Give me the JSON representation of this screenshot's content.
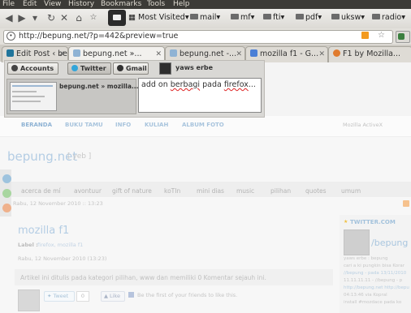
{
  "menubar": {
    "items": [
      "File",
      "Edit",
      "View",
      "History",
      "Bookmarks",
      "Tools",
      "Help"
    ]
  },
  "bookmarks": [
    "Most Visited",
    "mail",
    "mf",
    "fti",
    "pdf",
    "uksw",
    "radio"
  ],
  "url": "http://bepung.net/?p=442&preview=true",
  "tabs": [
    "Edit Post ‹ be...",
    "bepung.net »...",
    "bepung.net -...",
    "mozilla f1 - G...",
    "F1 by Mozilla..."
  ],
  "popup": {
    "accounts_label": "Accounts",
    "twitter_label": "Twitter",
    "gmail_label": "Gmail",
    "user_name": "yaws erbe",
    "share_title": "bepung.net » mozilla...",
    "compose_prefix": "add on ",
    "compose_w1": "berbagi",
    "compose_mid": " pada ",
    "compose_w2": "firefox",
    "compose_suffix": "..."
  },
  "page": {
    "nav": [
      "BERANDA",
      "BUKU TAMU",
      "INFO",
      "KULIAH",
      "ALBUM FOTO"
    ],
    "nav_right": "Mozilla ActiveX",
    "site_title": "bepung.net",
    "site_tag": "[ yeb ]",
    "categories": [
      "acerca de mí",
      "avontuur",
      "gift of nature",
      "koTIn",
      "mini dias",
      "music",
      "pilihan",
      "quotes",
      "umum"
    ],
    "date_bar": "Rabu, 12 November 2010 :: 13:23",
    "post_title": "mozilla f1",
    "label_prefix": "Label :",
    "label_value": "firefox, mozilla f1",
    "post_date": "Rabu, 12 November 2010 (13:23)",
    "post_excerpt": "Artikel ini ditulis pada kategori pilihan, www dan memiliki 0 Komentar sejauh ini.",
    "tweet_label": "Tweet",
    "tweet_count": "0",
    "like_label": "Like",
    "fb_text": "Be the first of your friends to like this.",
    "sidebar_heading": "TWITTER.COM",
    "sidebar_handle": "/bepung",
    "sidebar_lines": [
      "yaws erbe : bepung",
      "cari a ki pungkin bisa Korar",
      "//bepung - pada 13/11/2010",
      "11.11.11.11 - //bepung - p",
      "http://bepung.net http://bepu",
      "04:13:46 via Kopral",
      "install #mozdace pada ko"
    ]
  },
  "colors": {
    "menubar": "#3c3b37",
    "twitter": "#33a5d9",
    "accent": "#8fb3d4"
  }
}
